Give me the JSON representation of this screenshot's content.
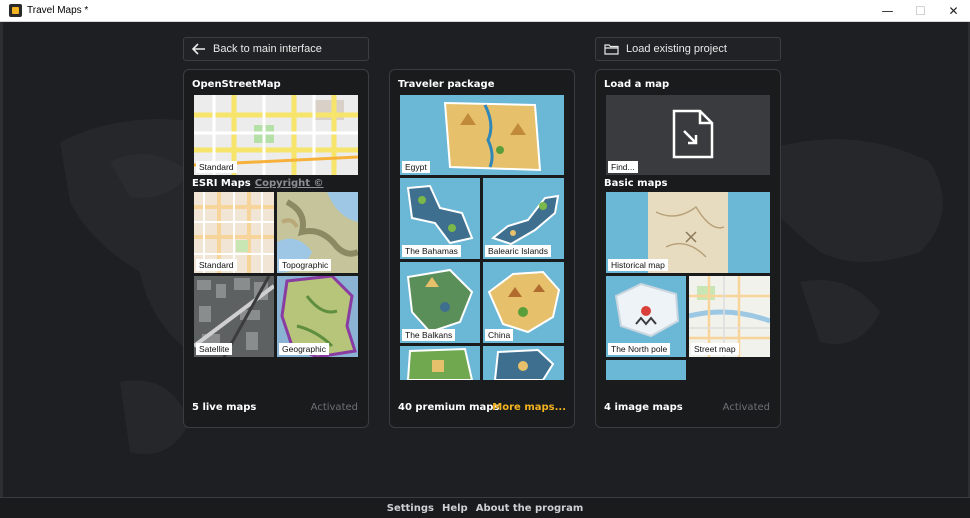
{
  "window": {
    "title": "Travel Maps *",
    "minimize": "—",
    "maximize": "☐",
    "close": "✕"
  },
  "top": {
    "back_label": "Back to main interface",
    "load_label": "Load existing project"
  },
  "panel_osm": {
    "title": "OpenStreetMap",
    "osm_tile_label": "Standard",
    "esri_title": "ESRI Maps",
    "esri_copyright": "Copyright ©",
    "tiles": [
      "Standard",
      "Topographic",
      "Satellite",
      "Geographic"
    ],
    "footer_left": "5 live maps",
    "footer_right": "Activated"
  },
  "panel_traveler": {
    "title": "Traveler package",
    "tiles": [
      "Egypt",
      "The Bahamas",
      "Balearic Islands",
      "The Balkans",
      "China"
    ],
    "footer_left": "40 premium maps",
    "footer_right": "More maps..."
  },
  "panel_load": {
    "title": "Load a map",
    "find_label": "Find...",
    "basic_title": "Basic maps",
    "tiles": [
      "Historical map",
      "The North pole",
      "Street map"
    ],
    "footer_left": "4 image maps",
    "footer_right": "Activated"
  },
  "bottom": {
    "settings": "Settings",
    "help": "Help",
    "about": "About the program"
  },
  "colors": {
    "accent": "#f3b320",
    "selection": "#e8a33a",
    "sea": "#6bb7d6",
    "background": "#1d1f22"
  }
}
